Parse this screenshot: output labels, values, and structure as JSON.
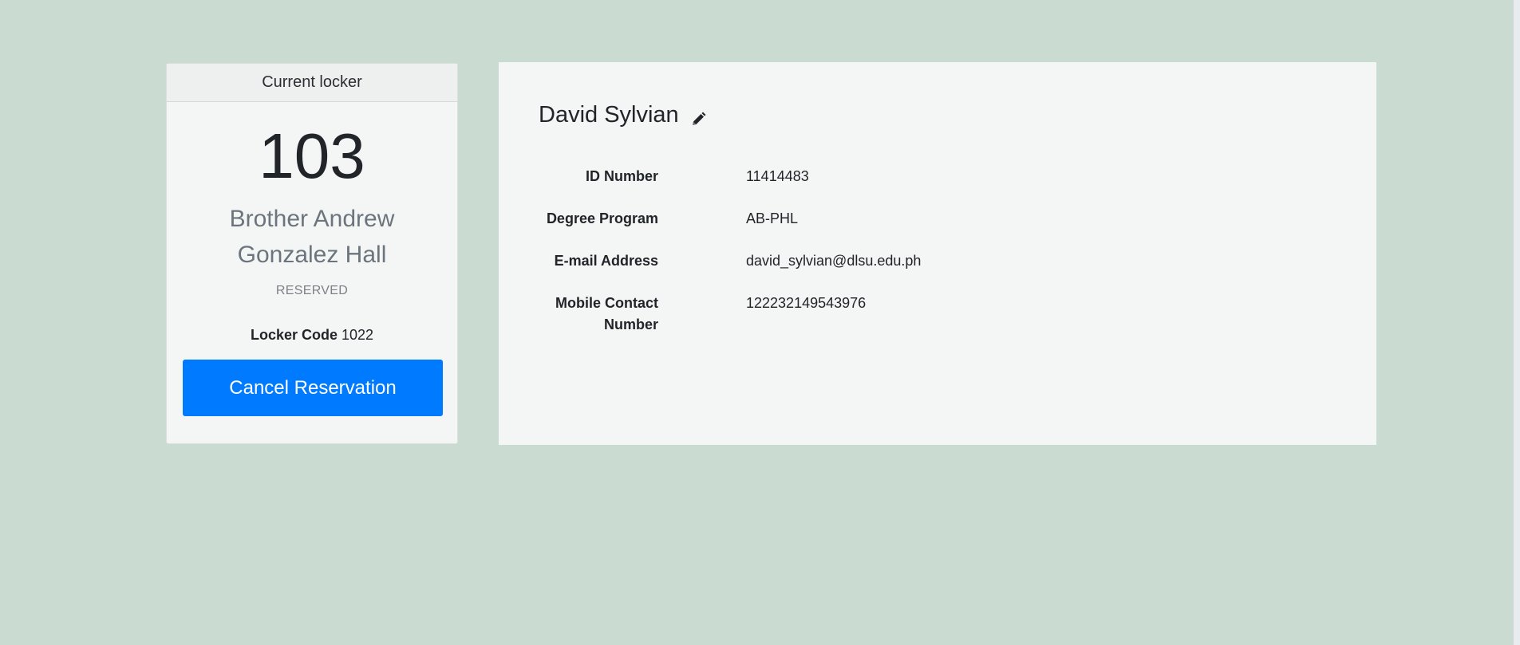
{
  "locker": {
    "header": "Current locker",
    "number": "103",
    "building": "Brother Andrew Gonzalez Hall",
    "status": "RESERVED",
    "code_label": "Locker Code",
    "code_value": "1022",
    "cancel_label": "Cancel Reservation"
  },
  "profile": {
    "name": "David Sylvian",
    "edit_icon": "pencil-icon",
    "fields": [
      {
        "label": "ID Number",
        "value": "11414483"
      },
      {
        "label": "Degree Program",
        "value": "AB-PHL"
      },
      {
        "label": "E-mail Address",
        "value": "david_sylvian@dlsu.edu.ph"
      },
      {
        "label": "Mobile Contact Number",
        "value": "122232149543976"
      }
    ]
  },
  "colors": {
    "background": "#cadbd2",
    "card": "#f4f6f5",
    "primary_button": "#007bff",
    "muted_text": "#6c757d"
  }
}
